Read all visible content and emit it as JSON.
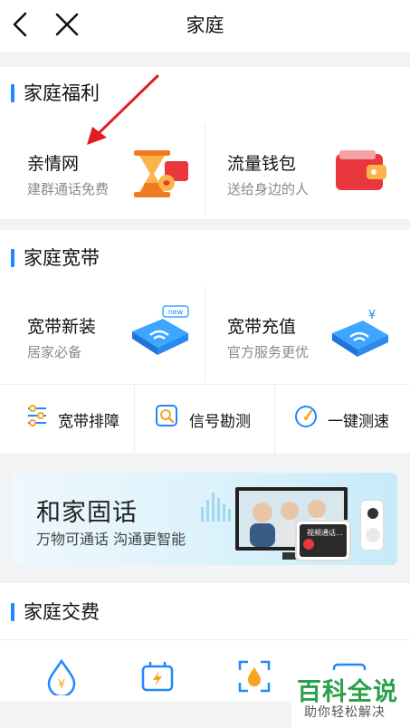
{
  "header": {
    "title": "家庭"
  },
  "welfare": {
    "title": "家庭福利",
    "items": [
      {
        "title": "亲情网",
        "subtitle": "建群通话免费"
      },
      {
        "title": "流量钱包",
        "subtitle": "送给身边的人"
      }
    ]
  },
  "broadband": {
    "title": "家庭宽带",
    "items": [
      {
        "title": "宽带新装",
        "subtitle": "居家必备"
      },
      {
        "title": "宽带充值",
        "subtitle": "官方服务更优"
      }
    ],
    "tools": [
      {
        "label": "宽带排障"
      },
      {
        "label": "信号勘测"
      },
      {
        "label": "一键测速"
      }
    ]
  },
  "banner": {
    "title": "和家固话",
    "subtitle": "万物可通话  沟通更智能",
    "screen_text": "视频通话..."
  },
  "payment": {
    "title": "家庭交费"
  },
  "watermark": {
    "brand": "百科全说",
    "slogan": "助你轻松解决"
  },
  "colors": {
    "accent": "#1f88ff",
    "orange": "#f07a22",
    "red": "#e8383d"
  }
}
